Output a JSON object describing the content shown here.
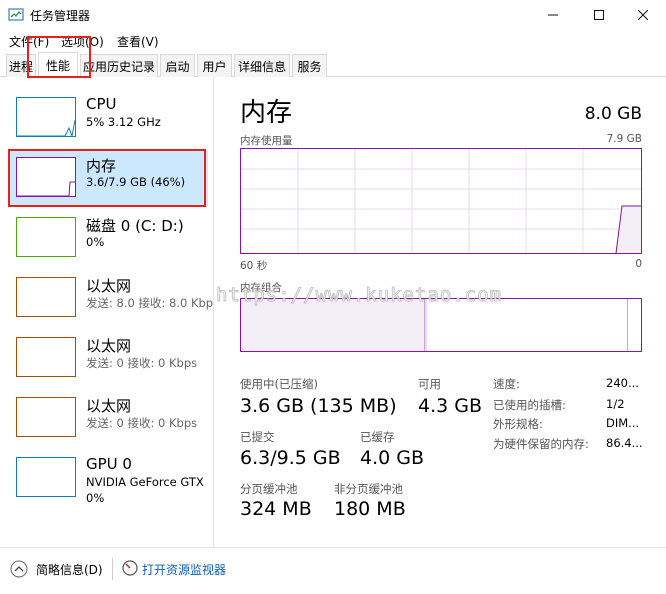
{
  "window": {
    "title": "任务管理器"
  },
  "menu": [
    "文件(F)",
    "选项(O)",
    "查看(V)"
  ],
  "tabs": [
    "进程",
    "性能",
    "应用历史记录",
    "启动",
    "用户",
    "详细信息",
    "服务"
  ],
  "resources": [
    {
      "name": "CPU",
      "sub": "5% 3.12 GHz",
      "color": "#117dbb"
    },
    {
      "name": "内存",
      "sub": "3.6/7.9 GB (46%)",
      "color": "#8b12ae"
    },
    {
      "name": "磁盘 0 (C: D:)",
      "sub": "0%",
      "color": "#4da60c"
    },
    {
      "name": "以太网",
      "sub": "发送: 8.0  接收: 8.0 Kbp",
      "color": "#a74f01"
    },
    {
      "name": "以太网",
      "sub": "发送: 0  接收: 0 Kbps",
      "color": "#a74f01"
    },
    {
      "name": "以太网",
      "sub": "发送: 0  接收: 0 Kbps",
      "color": "#a74f01"
    },
    {
      "name": "GPU 0",
      "sub": "NVIDIA GeForce GTX",
      "sub2": "0%",
      "color": "#117dbb"
    }
  ],
  "detail": {
    "title": "内存",
    "total": "8.0 GB",
    "usage_label": "内存使用量",
    "usage_max": "7.9 GB",
    "time_left": "60 秒",
    "time_right": "0",
    "composition_label": "内存组合",
    "in_use_label": "使用中(已压缩)",
    "in_use_value": "3.6 GB (135 MB)",
    "available_label": "可用",
    "available_value": "4.3 GB",
    "committed_label": "已提交",
    "committed_value": "6.3/9.5 GB",
    "cached_label": "已缓存",
    "cached_value": "4.0 GB",
    "paged_label": "分页缓冲池",
    "paged_value": "324 MB",
    "nonpaged_label": "非分页缓冲池",
    "nonpaged_value": "180 MB",
    "speed_label": "速度:",
    "speed_value": "240...",
    "slots_label": "已使用的插槽:",
    "slots_value": "1/2",
    "form_label": "外形规格:",
    "form_value": "DIM...",
    "reserved_label": "为硬件保留的内存:",
    "reserved_value": "86.4..."
  },
  "footer": {
    "brief": "简略信息(D)",
    "monitor": "打开资源监视器"
  },
  "watermark": "https://www.kuketao.com"
}
